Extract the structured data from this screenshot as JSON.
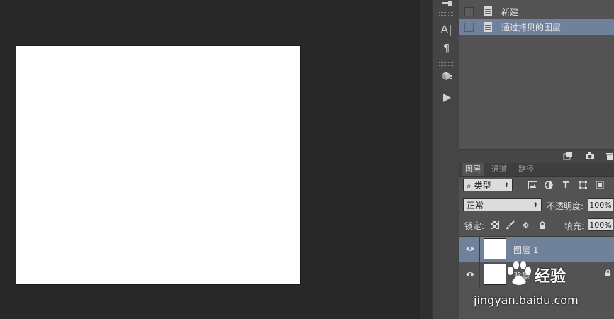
{
  "history": {
    "items": [
      {
        "label": "新建",
        "selected": false
      },
      {
        "label": "通过拷贝的图层",
        "selected": true
      }
    ]
  },
  "layers_panel": {
    "tabs": [
      "图层",
      "通道",
      "路径"
    ],
    "active_tab": "图层",
    "filter_kind": "类型",
    "blend_mode": "正常",
    "opacity_label": "不透明度:",
    "opacity_value": "100%",
    "lock_label": "锁定:",
    "fill_label": "填充:",
    "fill_value": "100%",
    "layers": [
      {
        "name": "图层 1",
        "selected": true,
        "visible": true,
        "locked": false
      },
      {
        "name": "背景",
        "selected": false,
        "visible": true,
        "locked": true
      }
    ]
  },
  "watermark": {
    "brand": "经验",
    "url": "jingyan.baidu.com"
  },
  "colors": {
    "selection": "#6f819b",
    "panel_bg": "#535353",
    "canvas_bg": "#282828"
  }
}
